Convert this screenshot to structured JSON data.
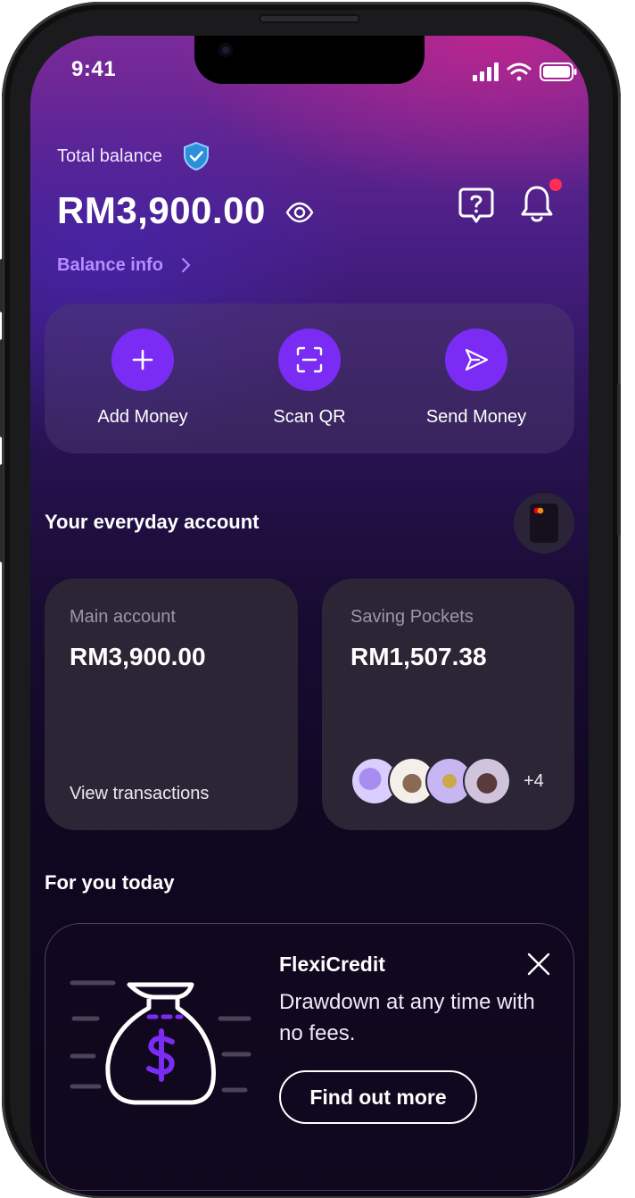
{
  "status_bar": {
    "time": "9:41"
  },
  "header": {
    "total_balance_label": "Total balance",
    "balance_amount": "RM3,900.00",
    "balance_info_link": "Balance info"
  },
  "quick_actions": [
    {
      "label": "Add Money",
      "icon": "plus-icon"
    },
    {
      "label": "Scan QR",
      "icon": "scan-qr-icon"
    },
    {
      "label": "Send Money",
      "icon": "send-icon"
    }
  ],
  "everyday": {
    "title": "Your everyday account",
    "main_account": {
      "name": "Main account",
      "amount": "RM3,900.00",
      "link": "View transactions"
    },
    "saving_pockets": {
      "name": "Saving Pockets",
      "amount": "RM1,507.38",
      "more_count": "+4"
    }
  },
  "for_you": {
    "title": "For you today",
    "promo": {
      "title": "FlexiCredit",
      "description": "Drawdown at any time with no fees.",
      "cta": "Find out more"
    }
  },
  "colors": {
    "accent": "#7b2cf4",
    "link": "#b98cff",
    "notification_dot": "#ff2d55",
    "card_bg": "#2b2536"
  }
}
